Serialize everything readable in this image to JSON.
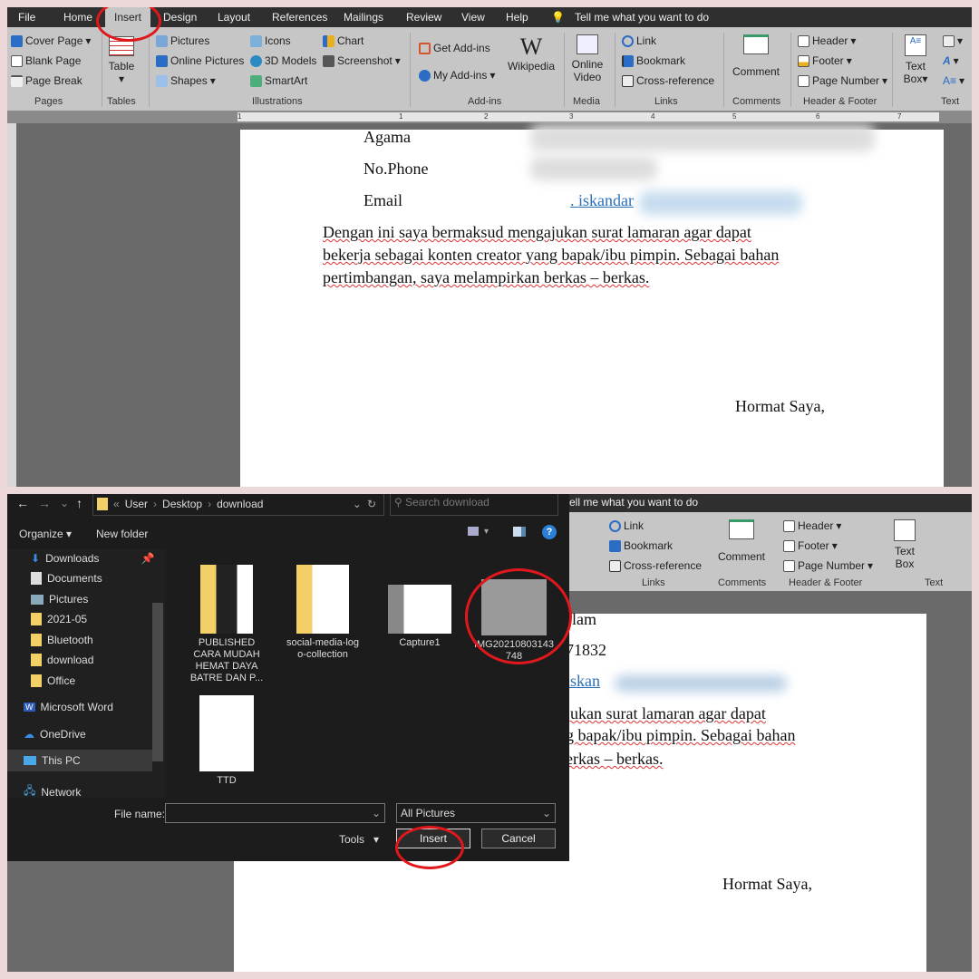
{
  "tabs": [
    "File",
    "Home",
    "Insert",
    "Design",
    "Layout",
    "References",
    "Mailings",
    "Review",
    "View",
    "Help"
  ],
  "tell_me": "Tell me what you want to do",
  "ribbon": {
    "pages": [
      "Cover Page",
      "Blank Page",
      "Page Break"
    ],
    "pages_group": "Pages",
    "table": "Table",
    "tables_group": "Tables",
    "illustrations": [
      "Pictures",
      "Online Pictures",
      "Shapes",
      "Icons",
      "3D Models",
      "SmartArt",
      "Chart",
      "Screenshot"
    ],
    "illustrations_group": "Illustrations",
    "addins": [
      "Get Add-ins",
      "My Add-ins",
      "Wikipedia"
    ],
    "addins_group": "Add-ins",
    "media": "Online Video",
    "media_group": "Media",
    "links": [
      "Link",
      "Bookmark",
      "Cross-reference"
    ],
    "links_group": "Links",
    "comment": "Comment",
    "comments_group": "Comments",
    "hf": [
      "Header",
      "Footer",
      "Page Number"
    ],
    "hf_group": "Header & Footer",
    "textbox": "Text Box",
    "text_group": "Text"
  },
  "ruler_numbers": [
    "1",
    "1",
    "2",
    "3",
    "4",
    "5",
    "6",
    "7"
  ],
  "doc_top": {
    "agama": "Agama",
    "phone": "No.Phone",
    "email": "Email",
    "email_value": ". iskandar",
    "para": [
      "Dengan ini saya bermaksud mengajukan surat lamaran agar dapat",
      "bekerja sebagai konten creator yang bapak/ibu pimpin. Sebagai bahan",
      "pertimbangan, saya melampirkan berkas – berkas."
    ],
    "closing": "Hormat Saya,"
  },
  "doc_bottom": {
    "lines": [
      "slam",
      "71832",
      "iskan",
      "jukan surat lamaran agar dapat",
      "g bapak/ibu pimpin. Sebagai bahan",
      "erkas – berkas."
    ],
    "closing": "Hormat Saya,",
    "tell_me": "ell me what you want to do"
  },
  "dialog": {
    "breadcrumb": [
      "User",
      "Desktop",
      "download"
    ],
    "search_placeholder": "Search download",
    "organize": "Organize",
    "new_folder": "New folder",
    "nav": [
      "Downloads",
      "Documents",
      "Pictures",
      "2021-05",
      "Bluetooth",
      "download",
      "Office",
      "Microsoft Word",
      "OneDrive",
      "This PC",
      "Network"
    ],
    "files": [
      "PUBLISHED CARA MUDAH HEMAT DAYA BATRE DAN P...",
      "social-media-log o-collection",
      "Capture1",
      "IMG20210803143 748",
      "TTD"
    ],
    "file_name_label": "File name:",
    "file_name_value": "",
    "filter": "All Pictures",
    "tools": "Tools",
    "insert": "Insert",
    "cancel": "Cancel"
  }
}
